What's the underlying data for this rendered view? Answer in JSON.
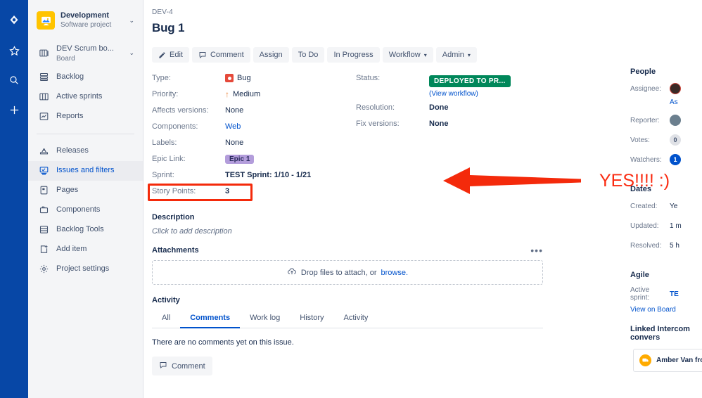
{
  "rail": {
    "icons": [
      {
        "name": "jira-logo-icon"
      },
      {
        "name": "star-icon"
      },
      {
        "name": "search-icon"
      },
      {
        "name": "plus-icon"
      }
    ]
  },
  "sidebar": {
    "project": {
      "name": "Development",
      "subtitle": "Software project",
      "avatar_color": "#FFC400",
      "expand_glyph": "⌄"
    },
    "board": {
      "label": "DEV Scrum bo...",
      "subtitle": "Board",
      "expand_glyph": "⌄"
    },
    "items": [
      {
        "label": "Backlog",
        "icon": "backlog-icon",
        "active": false
      },
      {
        "label": "Active sprints",
        "icon": "board-columns-icon",
        "active": false
      },
      {
        "label": "Reports",
        "icon": "reports-icon",
        "active": false
      }
    ],
    "items2": [
      {
        "label": "Releases",
        "icon": "releases-icon",
        "active": false
      },
      {
        "label": "Issues and filters",
        "icon": "issues-filters-icon",
        "active": true
      },
      {
        "label": "Pages",
        "icon": "pages-icon",
        "active": false
      },
      {
        "label": "Components",
        "icon": "components-icon",
        "active": false
      },
      {
        "label": "Backlog Tools",
        "icon": "backlog-tools-icon",
        "active": false
      },
      {
        "label": "Add item",
        "icon": "add-item-icon",
        "active": false
      },
      {
        "label": "Project settings",
        "icon": "gear-icon",
        "active": false
      }
    ]
  },
  "issue": {
    "breadcrumb": "DEV-4",
    "title": "Bug 1",
    "toolbar": [
      {
        "label": "Edit",
        "icon": "pencil-icon",
        "caret": false
      },
      {
        "label": "Comment",
        "icon": "comment-icon",
        "caret": false
      },
      {
        "label": "Assign",
        "icon": "",
        "caret": false
      },
      {
        "label": "To Do",
        "icon": "",
        "caret": false
      },
      {
        "label": "In Progress",
        "icon": "",
        "caret": false
      },
      {
        "label": "Workflow",
        "icon": "",
        "caret": true
      },
      {
        "label": "Admin",
        "icon": "",
        "caret": true
      }
    ],
    "fields_left": [
      {
        "label": "Type:",
        "value": "Bug",
        "kind": "bug"
      },
      {
        "label": "Priority:",
        "value": "Medium",
        "kind": "priority"
      },
      {
        "label": "Affects versions:",
        "value": "None",
        "kind": "text"
      },
      {
        "label": "Components:",
        "value": "Web",
        "kind": "link"
      },
      {
        "label": "Labels:",
        "value": "None",
        "kind": "text"
      },
      {
        "label": "Epic Link:",
        "value": "Epic 1",
        "kind": "epic"
      },
      {
        "label": "Sprint:",
        "value": "TEST Sprint: 1/10 - 1/21",
        "kind": "bold"
      },
      {
        "label": "Story Points:",
        "value": "3",
        "kind": "text"
      }
    ],
    "fields_right": {
      "status_label": "Status:",
      "status_value": "DEPLOYED TO PR...",
      "status_color": "#00875A",
      "view_workflow": "(View workflow)",
      "resolution_label": "Resolution:",
      "resolution_value": "Done",
      "fixversions_label": "Fix versions:",
      "fixversions_value": "None"
    },
    "description": {
      "title": "Description",
      "placeholder": "Click to add description"
    },
    "attachments": {
      "title": "Attachments",
      "more_glyph": "•••",
      "drop_text": "Drop files to attach, or ",
      "drop_link": "browse."
    },
    "activity": {
      "title": "Activity",
      "tabs": [
        {
          "label": "All",
          "active": false
        },
        {
          "label": "Comments",
          "active": true
        },
        {
          "label": "Work log",
          "active": false
        },
        {
          "label": "History",
          "active": false
        },
        {
          "label": "Activity",
          "active": false
        }
      ],
      "empty_text": "There are no comments yet on this issue.",
      "comment_button": "Comment"
    }
  },
  "right_sidebar": {
    "people_title": "People",
    "assignee_label": "Assignee:",
    "assignee_link": "As",
    "reporter_label": "Reporter:",
    "votes_label": "Votes:",
    "votes_value": "0",
    "watchers_label": "Watchers:",
    "watchers_value": "1",
    "dates_title": "Dates",
    "created_label": "Created:",
    "created_value": "Ye",
    "updated_label": "Updated:",
    "updated_value": "1 m",
    "resolved_label": "Resolved:",
    "resolved_value": "5 h",
    "agile_title": "Agile",
    "active_sprint_label": "Active sprint:",
    "active_sprint_value": "TE",
    "view_on_board": "View on Board",
    "intercom_title": "Linked Intercom convers",
    "intercom_name": "Amber Van from C"
  },
  "annotation": {
    "text": "YES!!!! :)",
    "color": "#FA2B11",
    "highlight_color": "#F42A0B"
  }
}
